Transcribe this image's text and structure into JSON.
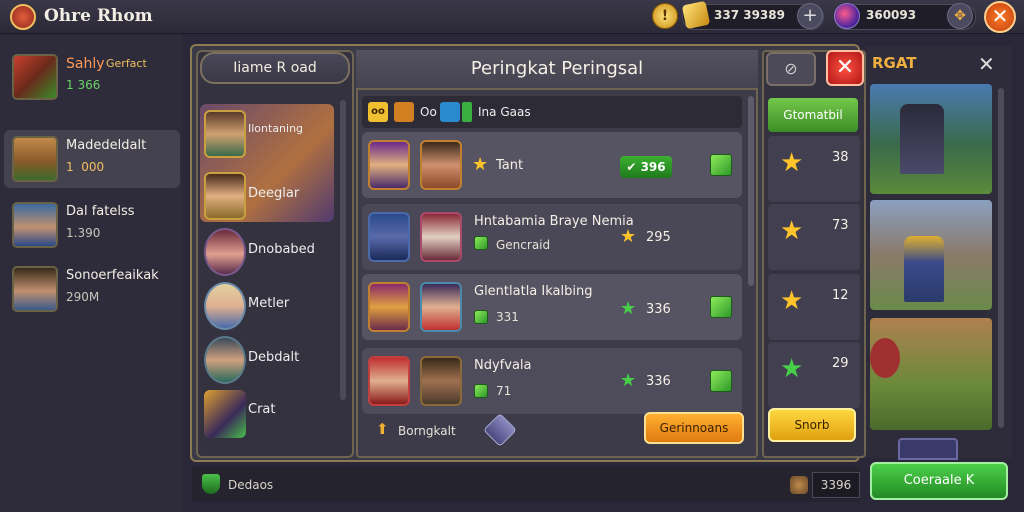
{
  "topbar": {
    "app_name": "Ohre Rhom",
    "currency1": "337 39389",
    "currency2": "360093",
    "plus": "+",
    "close": "✕"
  },
  "sidebar": {
    "items": [
      {
        "name": "Sahly",
        "tag": "Gerfact",
        "sub": "1 366",
        "sub_color": "#6ed06a"
      },
      {
        "name": "Madedeldalt",
        "sub": "1  000",
        "sub_color": "#f0c060"
      },
      {
        "name": "Dal fatelss",
        "sub": "1.390",
        "sub_color": "#c8c4b8"
      },
      {
        "name": "Sonoerfeaikak",
        "sub": "290M",
        "sub_color": "#c8c4b8"
      }
    ]
  },
  "left_panel": {
    "header": "Iiame R oad",
    "heroes": [
      {
        "name": "Ilontaning"
      },
      {
        "name": "Deeglar"
      },
      {
        "name": "Dnobabed"
      },
      {
        "name": "Metler"
      },
      {
        "name": "Debdalt"
      },
      {
        "name": "Crat"
      }
    ]
  },
  "main": {
    "title": "Peringkat Peringsal",
    "filter_oo": "Oo",
    "filter_label": "Ina Gaas",
    "rows": [
      {
        "title": "Tant",
        "value": "396",
        "has_pill": true
      },
      {
        "title": "Hntabamia Braye Nemia",
        "sub": "Gencraid",
        "value": "295"
      },
      {
        "title": "Glentlatla Ikalbing",
        "sub": "331",
        "value": "336"
      },
      {
        "title": "Ndyfvala",
        "sub": "71",
        "value": "336"
      }
    ],
    "footer_label": "Borngkalt",
    "gains_button": "Gerinnoans"
  },
  "right_panel": {
    "status_button": "Gtomatbil",
    "ranks": [
      "38",
      "73",
      "12",
      "29"
    ],
    "stock_button": "Snorb"
  },
  "far_right": {
    "title": "RGAT",
    "close": "✕",
    "create_button": "Coeraale K"
  },
  "bottom": {
    "label": "Dedaos",
    "value": "3396"
  }
}
